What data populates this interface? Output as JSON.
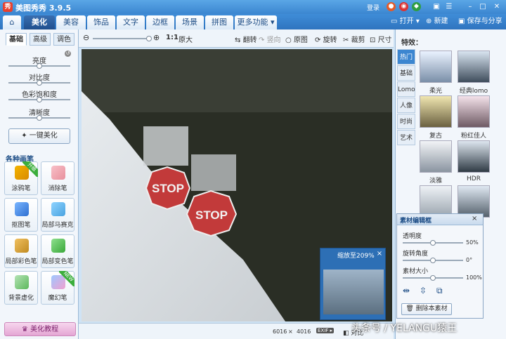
{
  "window": {
    "title": "美图秀秀 3.9.5",
    "logo_glyph": "秀",
    "login": "登录"
  },
  "menu": {
    "tabs": [
      {
        "label": "美化",
        "active": true
      },
      {
        "label": "美容"
      },
      {
        "label": "饰品"
      },
      {
        "label": "文字"
      },
      {
        "label": "边框"
      },
      {
        "label": "场景"
      },
      {
        "label": "拼图"
      },
      {
        "label": "更多功能 ▾"
      }
    ],
    "open": "打开 ▾",
    "new": "新建",
    "save": "保存与分享"
  },
  "left": {
    "subtabs": [
      "基础",
      "高级",
      "调色"
    ],
    "sliders": [
      {
        "label": "亮度",
        "value": 0.5
      },
      {
        "label": "对比度",
        "value": 0.5
      },
      {
        "label": "色彩饱和度",
        "value": 0.5
      },
      {
        "label": "清晰度",
        "value": 0.5
      }
    ],
    "beautify": "一键美化",
    "brush_title": "各种画笔",
    "tools": [
      {
        "label": "涂鸦笔",
        "badge": "升级"
      },
      {
        "label": "消除笔"
      },
      {
        "label": "抠图笔"
      },
      {
        "label": "局部马赛克"
      },
      {
        "label": "局部彩色笔"
      },
      {
        "label": "局部变色笔"
      },
      {
        "label": "背景虚化"
      },
      {
        "label": "魔幻笔",
        "badge": "NEW"
      }
    ],
    "tutorial": "美化教程"
  },
  "toolbar": {
    "zoom_ratio": "1:1",
    "original_size": "原大",
    "flip_h": "翻转",
    "flip_v": "竖向",
    "original": "原图",
    "rotate": "旋转",
    "crop": "裁剪",
    "size": "尺寸"
  },
  "status": {
    "width": "6016",
    "times": "×",
    "height": "4016",
    "exif": "EXIF ▸",
    "compare": "对比"
  },
  "right": {
    "title": "特效：",
    "categories": [
      "热门",
      "基础",
      "Lomo",
      "人像",
      "时尚",
      "艺术"
    ],
    "effects": [
      "柔光",
      "经典lomo",
      "复古",
      "粉红佳人",
      "淡雅",
      "HDR"
    ]
  },
  "zoom_popup": {
    "title": "缩放至209%",
    "close": "×"
  },
  "material": {
    "title": "素材编辑框",
    "close": "×",
    "rows": [
      {
        "label": "透明度",
        "value_text": "50%",
        "value": 0.5
      },
      {
        "label": "旋转角度",
        "value_text": "0°",
        "value": 0.5
      },
      {
        "label": "素材大小",
        "value_text": "100%",
        "value": 0.5
      }
    ],
    "delete": "删除本素材"
  },
  "canvas_signs": {
    "stop1": "STOP",
    "stop2": "STOP"
  },
  "watermark": "头条号 / YELANGU猿王",
  "colors": {
    "accent": "#3c86d0",
    "stop": "#c23a3a"
  }
}
